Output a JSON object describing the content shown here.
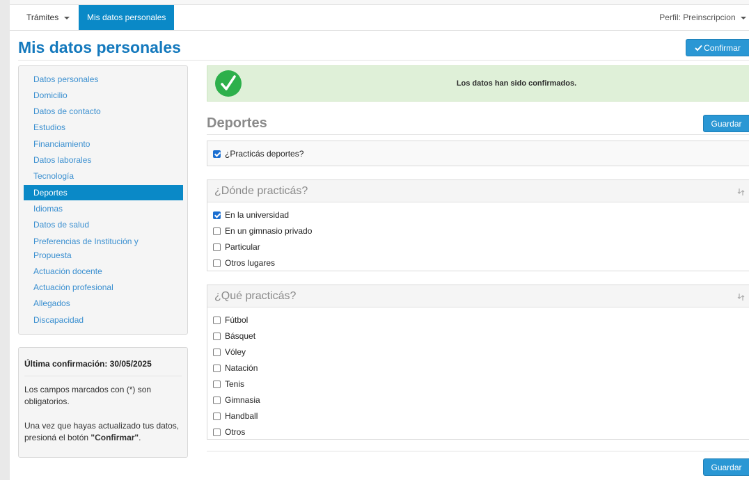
{
  "nav": {
    "tramites": "Trámites",
    "active": "Mis datos personales",
    "perfil": "Perfil: Preinscripcion"
  },
  "page": {
    "title": "Mis datos personales",
    "confirm_label": "Confirmar"
  },
  "sidebar": {
    "items": [
      "Datos personales",
      "Domicilio",
      "Datos de contacto",
      "Estudios",
      "Financiamiento",
      "Datos laborales",
      "Tecnología",
      "Deportes",
      "Idiomas",
      "Datos de salud",
      "Preferencias de Institución y",
      "Propuesta",
      "Actuación docente",
      "Actuación profesional",
      "Allegados",
      "Discapacidad"
    ],
    "active_index": 7
  },
  "info": {
    "title": "Última confirmación: 30/05/2025",
    "p1_line1": "Los campos marcados con (*) son",
    "p1_line2": "obligatorios.",
    "p2_line1": "Una vez que hayas actualizado tus datos,",
    "p2_line2_a": "presioná el botón ",
    "p2_line2_b": "\"Confirmar\"",
    "p2_line2_c": "."
  },
  "alert": {
    "message": "Los datos han sido confirmados."
  },
  "section": {
    "title": "Deportes",
    "save_label": "Guardar",
    "practica": {
      "label": "¿Practicás deportes?",
      "checked": true
    }
  },
  "donde": {
    "title": "¿Dónde practicás?",
    "options": [
      {
        "label": "En la universidad",
        "checked": true
      },
      {
        "label": "En un gimnasio privado",
        "checked": false
      },
      {
        "label": "Particular",
        "checked": false
      },
      {
        "label": "Otros lugares",
        "checked": false
      }
    ]
  },
  "que": {
    "title": "¿Qué practicás?",
    "options": [
      {
        "label": "Fútbol",
        "checked": false
      },
      {
        "label": "Básquet",
        "checked": false
      },
      {
        "label": "Vóley",
        "checked": false
      },
      {
        "label": "Natación",
        "checked": false
      },
      {
        "label": "Tenis",
        "checked": false
      },
      {
        "label": "Gimnasia",
        "checked": false
      },
      {
        "label": "Handball",
        "checked": false
      },
      {
        "label": "Otros",
        "checked": false
      }
    ]
  },
  "colors": {
    "brand": "#0a89c7",
    "button": "#2a97d4",
    "title": "#1479bd",
    "success_bg": "#dff0d8",
    "success_icon": "#2db04b"
  },
  "icons": {
    "confirm": "checkmark-icon",
    "alert": "success-check-icon",
    "panel": "sort-icon",
    "nav": "caret-down-icon"
  }
}
